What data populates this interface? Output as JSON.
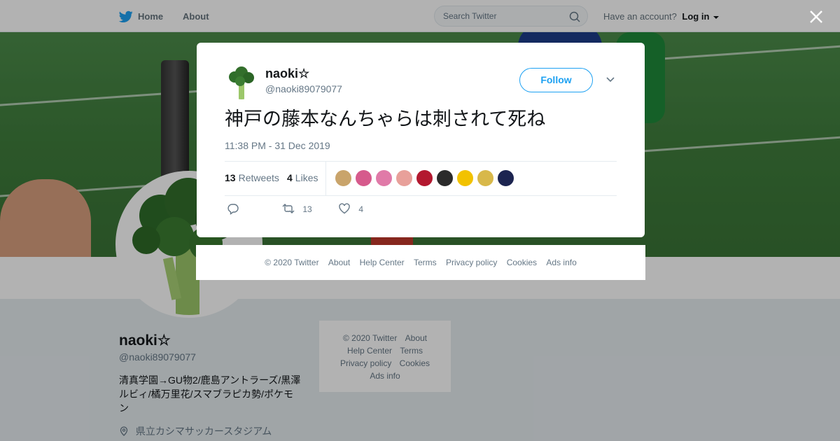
{
  "topbar": {
    "home_label": "Home",
    "about_label": "About",
    "search_placeholder": "Search Twitter",
    "account_prompt": "Have an account?",
    "login_label": "Log in"
  },
  "profile": {
    "name": "naoki☆",
    "handle": "@naoki89079077",
    "bio": "清真学園→GU物2/鹿島アントラーズ/黒澤ルビィ/橘万里花/スマブラピカ勢/ポケモン",
    "location": "県立カシマサッカースタジアム"
  },
  "side_footer": {
    "copyright": "© 2020 Twitter",
    "about": "About",
    "help": "Help Center",
    "terms": "Terms",
    "privacy": "Privacy policy",
    "cookies": "Cookies",
    "ads": "Ads info"
  },
  "tweet": {
    "author_name": "naoki☆",
    "author_handle": "@naoki89079077",
    "follow_label": "Follow",
    "text": "神戸の藤本なんちゃらは刺されて死ね",
    "timestamp": "11:38 PM - 31 Dec 2019",
    "retweets_count": "13",
    "retweets_label": "Retweets",
    "likes_count": "4",
    "likes_label": "Likes",
    "retweet_action_count": "13",
    "like_action_count": "4",
    "liker_avatar_colors": [
      "#c9a46b",
      "#d65a8c",
      "#e07aa8",
      "#e8a09a",
      "#b3182f",
      "#2b2b2b",
      "#f2c200",
      "#d8b84a",
      "#1c2450"
    ]
  },
  "modal_footer": {
    "copyright": "© 2020 Twitter",
    "about": "About",
    "help": "Help Center",
    "terms": "Terms",
    "privacy": "Privacy policy",
    "cookies": "Cookies",
    "ads": "Ads info"
  },
  "colors": {
    "accent": "#1da1f2",
    "muted_text": "#657786"
  }
}
